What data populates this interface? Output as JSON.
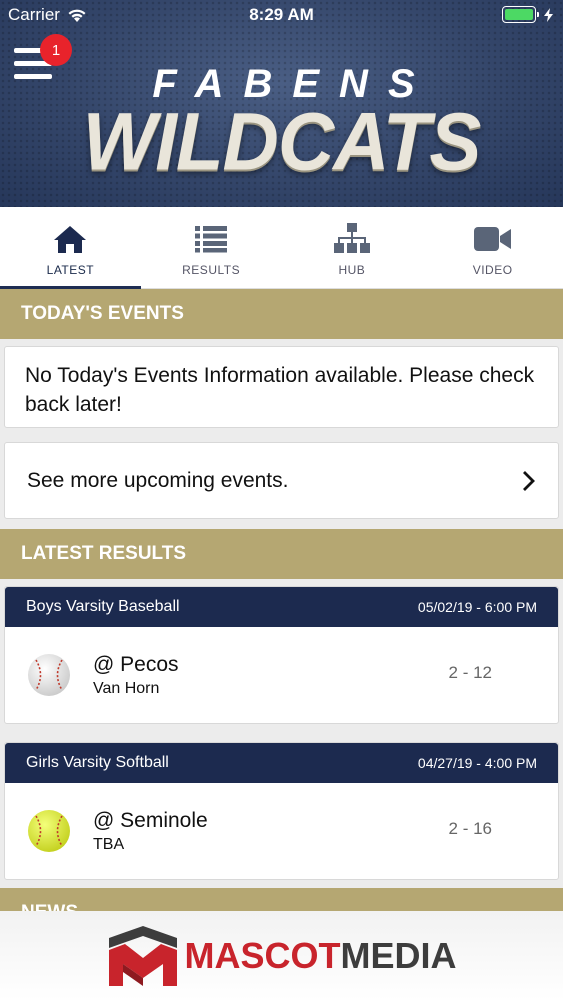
{
  "status_bar": {
    "carrier": "Carrier",
    "time": "8:29 AM"
  },
  "header": {
    "menu_badge": "1",
    "school_name": "FABENS",
    "team_name": "WILDCATS"
  },
  "tabs": [
    {
      "label": "LATEST",
      "icon": "home-icon",
      "active": true
    },
    {
      "label": "RESULTS",
      "icon": "list-icon",
      "active": false
    },
    {
      "label": "HUB",
      "icon": "hub-icon",
      "active": false
    },
    {
      "label": "VIDEO",
      "icon": "video-camera-icon",
      "active": false
    }
  ],
  "todays_events": {
    "heading": "TODAY'S EVENTS",
    "message": "No Today's Events Information available. Please check back later!",
    "more_link": "See more upcoming events."
  },
  "latest_results": {
    "heading": "LATEST RESULTS",
    "items": [
      {
        "sport": "Boys Varsity Baseball",
        "datetime": "05/02/19 - 6:00 PM",
        "opponent": "@ Pecos",
        "location": "Van Horn",
        "score": "2 - 12",
        "icon": "baseball-icon"
      },
      {
        "sport": "Girls Varsity Softball",
        "datetime": "04/27/19 - 4:00 PM",
        "opponent": "@ Seminole",
        "location": "TBA",
        "score": "2 - 16",
        "icon": "softball-icon"
      }
    ]
  },
  "news": {
    "heading": "NEWS"
  },
  "footer": {
    "brand_part1": "MASCOT",
    "brand_part2": "MEDIA"
  },
  "colors": {
    "navy": "#1c2a4f",
    "gold": "#b5a772",
    "badge_red": "#e8232b",
    "brand_red": "#c8242c"
  }
}
